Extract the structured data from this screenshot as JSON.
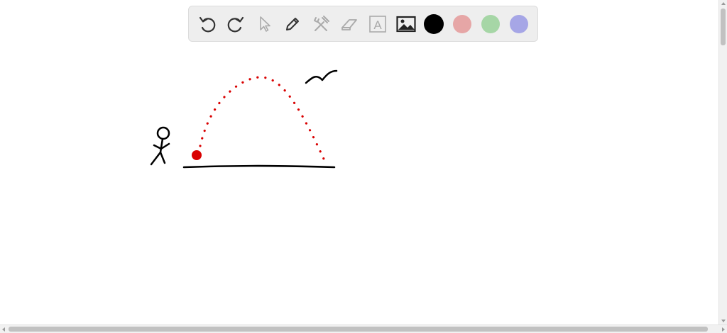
{
  "toolbar": {
    "tools": [
      {
        "name": "undo-icon",
        "state": "enabled"
      },
      {
        "name": "redo-icon",
        "state": "enabled"
      },
      {
        "name": "select-pointer-icon",
        "state": "disabled"
      },
      {
        "name": "pen-icon",
        "state": "active"
      },
      {
        "name": "tools-icon",
        "state": "disabled"
      },
      {
        "name": "eraser-icon",
        "state": "disabled"
      },
      {
        "name": "text-tool-icon",
        "state": "disabled",
        "glyph": "A"
      },
      {
        "name": "image-icon",
        "state": "enabled"
      }
    ],
    "colors": [
      "#000000",
      "#e6a6a6",
      "#a6d6a6",
      "#a6a6e6"
    ],
    "selected_color": "#000000"
  },
  "drawing": {
    "ink_colors": {
      "black": "#000000",
      "red": "#d90000"
    },
    "items": [
      "stick-figure",
      "ball",
      "trajectory",
      "ground-line",
      "bird"
    ]
  }
}
